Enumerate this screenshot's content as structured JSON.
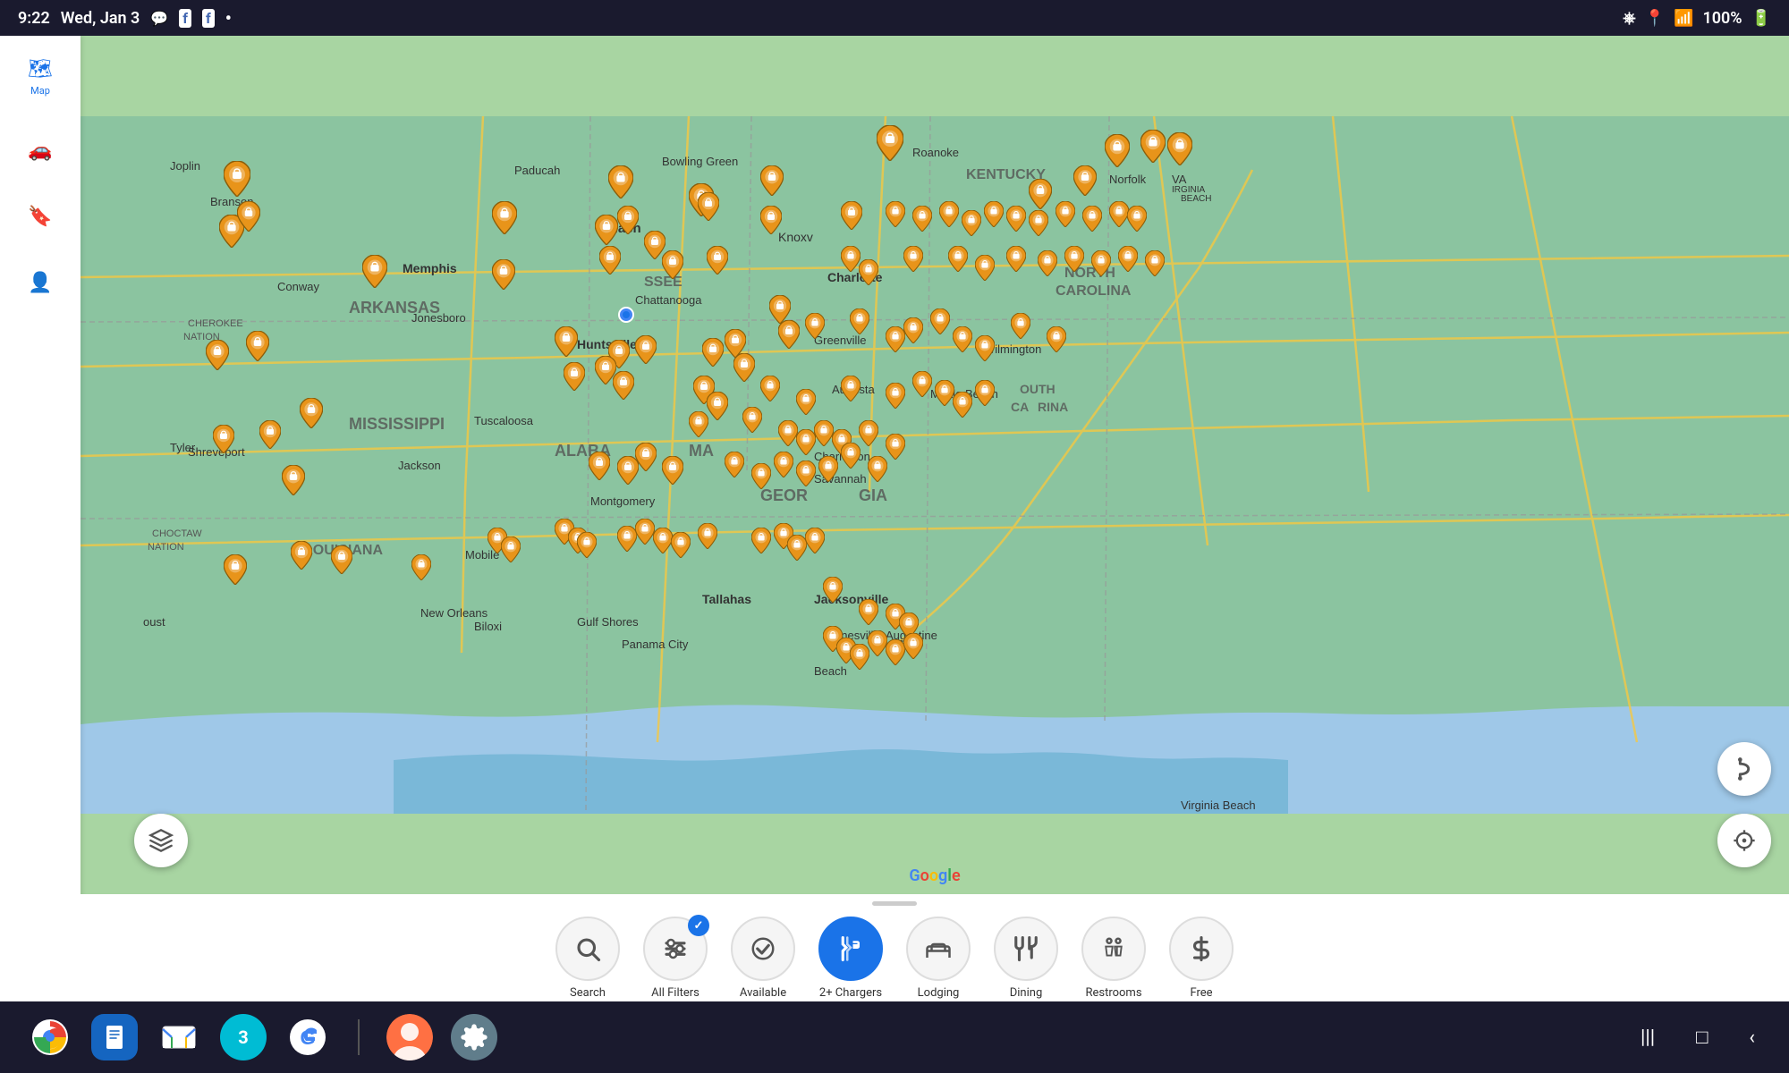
{
  "status_bar": {
    "time": "9:22",
    "day": "Wed, Jan 3",
    "battery": "100%",
    "icons": [
      "messenger",
      "facebook",
      "facebook2",
      "dot"
    ]
  },
  "sidebar": {
    "items": [
      {
        "id": "map",
        "label": "Map",
        "icon": "🗺",
        "active": true
      },
      {
        "id": "drive",
        "label": "",
        "icon": "🚗",
        "active": false
      },
      {
        "id": "bookmark",
        "label": "",
        "icon": "🔖",
        "active": false
      },
      {
        "id": "profile",
        "label": "",
        "icon": "👤",
        "active": false
      }
    ]
  },
  "map": {
    "google_watermark": [
      "G",
      "o",
      "o",
      "g",
      "l",
      "e"
    ],
    "layer_btn_icon": "⊞",
    "route_btn_icon": "⇅",
    "locate_btn_icon": "◎"
  },
  "bottom_panel": {
    "filters": [
      {
        "id": "search",
        "label": "Search",
        "icon": "🔍",
        "active": false,
        "checked": false
      },
      {
        "id": "all-filters",
        "label": "All Filters",
        "icon": "⚙",
        "active": false,
        "checked": true
      },
      {
        "id": "available",
        "label": "Available",
        "icon": "✓",
        "active": false,
        "checked": false
      },
      {
        "id": "2plus-chargers",
        "label": "2+ Chargers",
        "icon": "⛽",
        "active": true,
        "checked": false
      },
      {
        "id": "lodging",
        "label": "Lodging",
        "icon": "🛏",
        "active": false,
        "checked": false
      },
      {
        "id": "dining",
        "label": "Dining",
        "icon": "🍴",
        "active": false,
        "checked": false
      },
      {
        "id": "restrooms",
        "label": "Restrooms",
        "icon": "👥",
        "active": false,
        "checked": false
      },
      {
        "id": "free",
        "label": "Free",
        "icon": "$",
        "active": false,
        "checked": false
      }
    ]
  },
  "bottom_nav": {
    "apps": [
      {
        "id": "chrome",
        "label": "Chrome"
      },
      {
        "id": "samsung-notes",
        "label": "Samsung Notes"
      },
      {
        "id": "gmail",
        "label": "Gmail"
      },
      {
        "id": "num3",
        "label": "3"
      },
      {
        "id": "google",
        "label": "Google"
      },
      {
        "id": "avatar",
        "label": "Avatar"
      },
      {
        "id": "settings",
        "label": "Settings"
      }
    ],
    "sys_nav": [
      "|||",
      "□",
      "‹"
    ]
  }
}
